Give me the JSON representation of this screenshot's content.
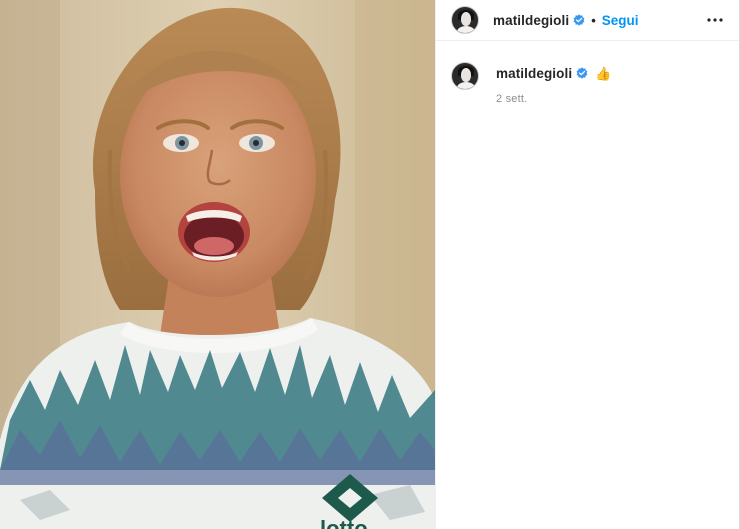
{
  "post": {
    "photo": {
      "subject": "girl-shouting-photo",
      "shirt_logo_text": "lotto"
    },
    "header": {
      "username": "matildegioli",
      "separator": "•",
      "follow_label": "Segui",
      "more_icon": "more-horizontal-icon"
    },
    "caption": {
      "username": "matildegioli",
      "emoji": "👍",
      "timestamp": "2 sett."
    }
  },
  "colors": {
    "link_blue": "#0095f6",
    "verified_blue": "#3897f0",
    "text": "#262626",
    "secondary_text": "#8e8e8e",
    "divider": "#efefef"
  }
}
